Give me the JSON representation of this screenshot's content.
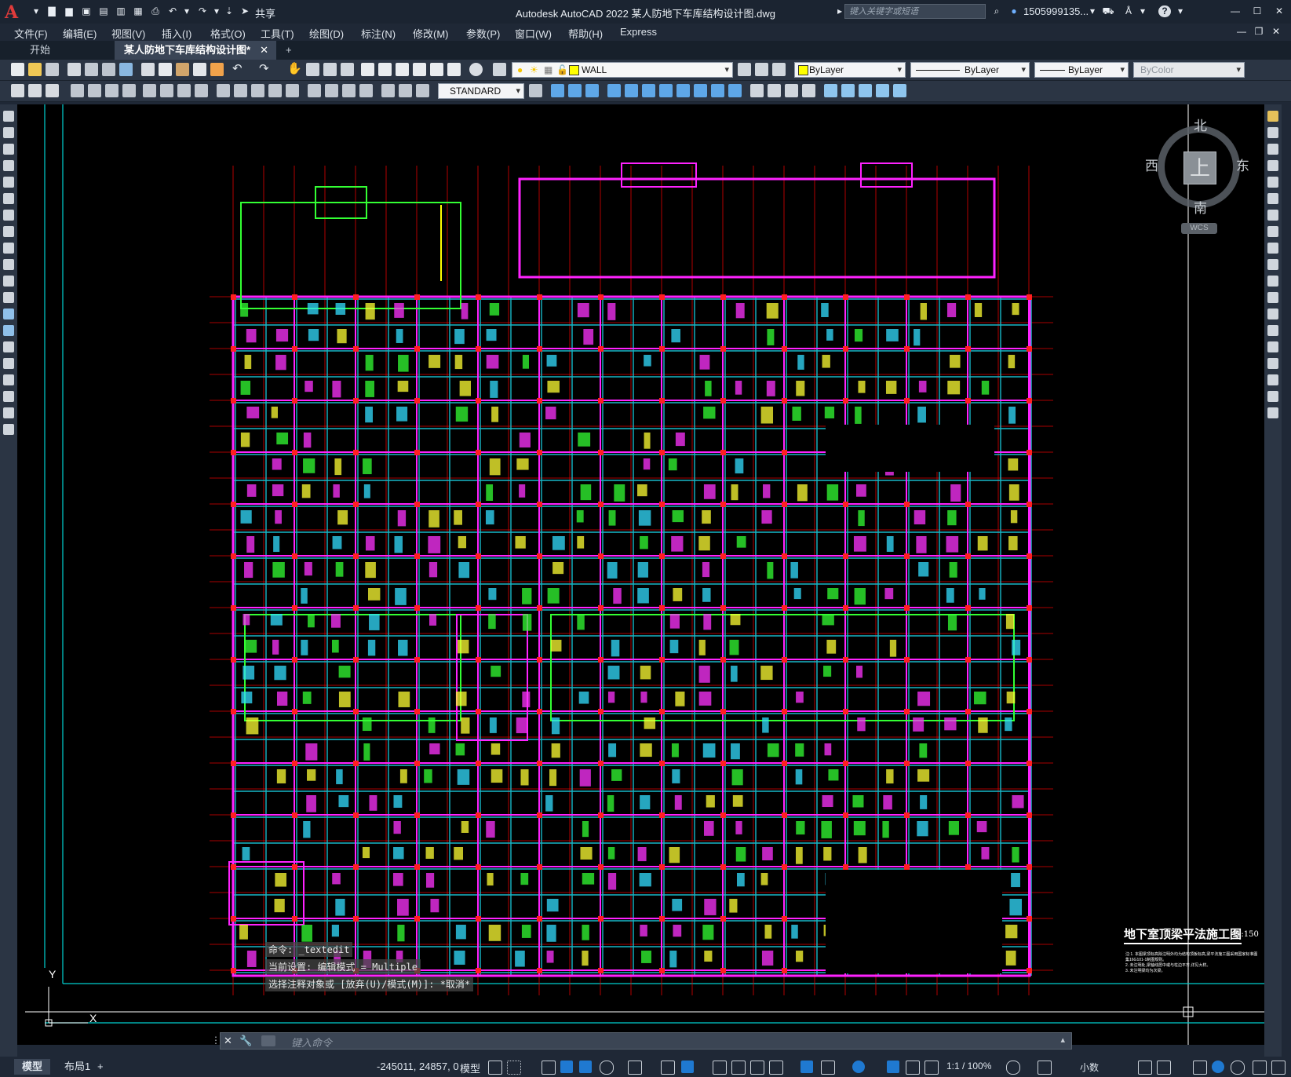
{
  "window": {
    "title": "Autodesk AutoCAD 2022    某人防地下车库结构设计图.dwg",
    "app_letter": "A",
    "share_label": "共享",
    "search_placeholder": "键入关键字或短语",
    "user": "1505999135...",
    "help": "?"
  },
  "menu": [
    "文件(F)",
    "编辑(E)",
    "视图(V)",
    "插入(I)",
    "格式(O)",
    "工具(T)",
    "绘图(D)",
    "标注(N)",
    "修改(M)",
    "参数(P)",
    "窗口(W)",
    "帮助(H)",
    "Express"
  ],
  "tabs": {
    "start": "开始",
    "active": "某人防地下车库结构设计图*",
    "close": "✕",
    "add": "+"
  },
  "layer_toolbar": {
    "layer": "WALL",
    "color": "ByLayer",
    "linetype": "ByLayer",
    "lineweight": "ByLayer",
    "plotstyle": "ByColor",
    "layer_color": "#ffff00"
  },
  "style_toolbar": {
    "textstyle": "STANDARD"
  },
  "viewcube": {
    "north": "北",
    "south": "南",
    "east": "东",
    "west": "西",
    "top": "上",
    "wcs": "WCS"
  },
  "drawing": {
    "title": "地下室顶梁平法施工图",
    "scale": "1:150",
    "note1": "注:1. 本图梁顶标高除注明外均为结构顶板标高,梁平法施工图采用国家标准图集16G101-1制图规则。",
    "note2": "2. 未注明处,梁轴线居中或与柱边平齐,详见大样。",
    "note3": "3. 未注明梁均为次梁。"
  },
  "ucs": {
    "y": "Y",
    "x": "X"
  },
  "command": {
    "history": [
      "命令: _textedit",
      "当前设置: 编辑模式 = Multiple",
      "选择注释对象或 [放弃(U)/模式(M)]: *取消*"
    ],
    "placeholder": "键入命令"
  },
  "status": {
    "model_tab": "模型",
    "layout_tab": "布局1",
    "add": "+",
    "coords": "-245011, 24857, 0",
    "space": "模型",
    "scale": "1:1 / 100%",
    "units": "小数"
  }
}
